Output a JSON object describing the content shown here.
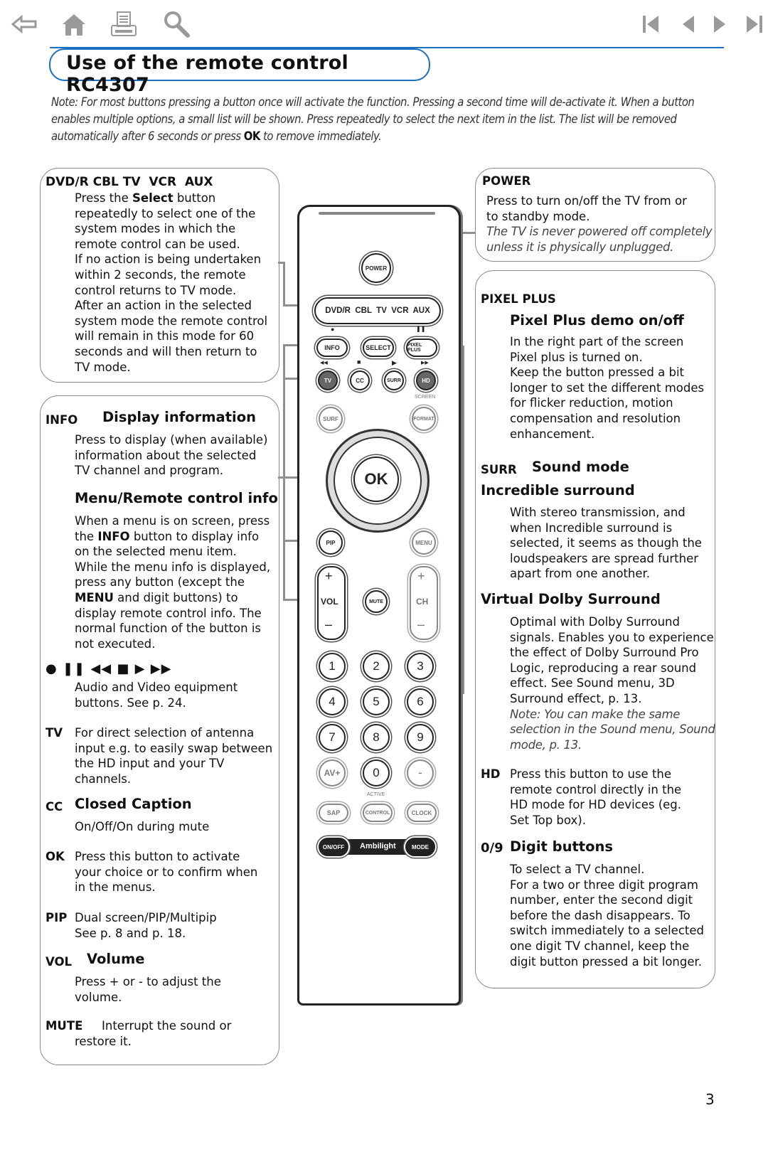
{
  "nav": {
    "left_icons": [
      "back-arrow-icon",
      "home-icon",
      "print-icon",
      "search-icon"
    ],
    "right_icons": [
      "first-page-icon",
      "previous-page-icon",
      "next-page-icon",
      "last-page-icon"
    ]
  },
  "title": "Use of the remote control RC4307",
  "note": {
    "part1": "Note: For most buttons pressing a button once will activate the function. Pressing a second time will de-activate it. When a button enables multiple options, a small list will be shown. Press repeatedly to select the next item in the list. The list will be removed automatically after 6 seconds or press ",
    "bold": "OK",
    "part2": " to remove immediately."
  },
  "left": {
    "modes": {
      "heading": "DVD/R CBL TV  VCR  AUX",
      "lines": [
        [
          "Press the ",
          "Select",
          " button"
        ],
        "repeatedly to select one of the",
        "system modes in which the",
        "remote control can be used.",
        "If no action is being undertaken",
        "within 2 seconds, the remote",
        "control returns to TV mode.",
        "After an action in the selected",
        "system mode the remote control",
        "will remain in this mode for 60",
        "seconds and will then return to",
        "TV mode."
      ]
    },
    "info": {
      "key": "INFO",
      "title": "Display information",
      "body": [
        "Press to display (when available)",
        "information about the selected",
        "TV channel and program."
      ],
      "sub_title": "Menu/Remote control info",
      "sub_body_1": "When a menu is on screen, press",
      "sub_body_2a": "the ",
      "sub_body_2b": "INFO",
      "sub_body_2c": " button to display info",
      "sub_body_3": "on the selected menu item.",
      "sub_body_4": "While the menu info is displayed,",
      "sub_body_5": "press any button (except the",
      "sub_body_6a": "MENU",
      "sub_body_6b": " and digit buttons) to",
      "sub_body_7": "display remote control info. The",
      "sub_body_8": "normal function of the button is",
      "sub_body_9": "not executed."
    },
    "av": {
      "symbols": "● ❚❚ ◀◀ ■ ▶ ▶▶",
      "body": [
        "Audio and Video equipment",
        "buttons. See p. 24."
      ]
    },
    "tv": {
      "key": "TV",
      "body": [
        "For direct selection of antenna",
        "input e.g. to easily swap between",
        "the HD input and your TV",
        "channels."
      ]
    },
    "cc": {
      "key": "CC",
      "title": "Closed Caption",
      "body": "On/Off/On during mute"
    },
    "ok": {
      "key": "OK",
      "body": [
        "Press this button to activate",
        "your choice or to confirm when",
        "in the menus."
      ]
    },
    "pip": {
      "key": "PIP",
      "body": [
        "Dual screen/PIP/Multipip",
        "See p. 8 and p. 18."
      ]
    },
    "vol": {
      "key": "VOL",
      "title": "Volume",
      "body": [
        "Press + or - to adjust the",
        "volume."
      ]
    },
    "mute": {
      "key": "MUTE",
      "body": [
        "Interrupt the sound or",
        "restore it."
      ]
    }
  },
  "right": {
    "power": {
      "key": "POWER",
      "body": [
        "Press to turn on/off the TV from or",
        "to standby mode."
      ],
      "note": [
        "The TV is never powered off completely",
        "unless it is physically unplugged."
      ]
    },
    "pixel": {
      "key": "PIXEL PLUS",
      "title": "Pixel Plus demo on/off",
      "body": [
        "In the right part of the screen",
        "Pixel plus is turned on.",
        "Keep the button pressed a bit",
        "longer to set the different modes",
        "for flicker reduction, motion",
        "compensation and resolution",
        "enhancement."
      ]
    },
    "surr": {
      "key": "SURR",
      "title": "Sound mode",
      "sub1_title": "Incredible surround",
      "sub1_body": [
        "With stereo transmission, and",
        "when Incredible surround is",
        "selected, it seems as though the",
        "loudspeakers are spread further",
        "apart from one another."
      ],
      "sub2_title": "Virtual Dolby Surround",
      "sub2_body": [
        "Optimal with Dolby Surround",
        "signals. Enables you to experience",
        "the effect of Dolby Surround Pro",
        "Logic, reproducing a rear sound",
        "effect. See Sound menu, 3D",
        "Surround effect, p. 13."
      ],
      "sub2_note": [
        "Note: You can make the same",
        "selection in the Sound menu, Sound",
        "mode, p. 13."
      ]
    },
    "hd": {
      "key": "HD",
      "body": [
        "Press this button to use the",
        "remote control directly in the",
        "HD mode for HD devices (eg.",
        "Set Top box)."
      ]
    },
    "digits": {
      "key": "0/9",
      "title": "Digit buttons",
      "body": [
        "To select a TV channel.",
        "For a two or three digit program",
        "number, enter the second digit",
        "before the dash disappears. To",
        "switch immediately to a selected",
        "one digit TV channel, keep the",
        "digit button pressed a bit longer."
      ]
    }
  },
  "remote": {
    "power": "POWER",
    "mode_strip": "DVD/R  CBL  TV  VCR  AUX",
    "info": "INFO",
    "select": "SELECT",
    "pixel_plus": "PIXEL PLUS",
    "rec": "●",
    "pause": "❚❚",
    "rew": "◀◀",
    "stop": "■",
    "play": "▶",
    "ff": "▶▶",
    "tv": "TV",
    "cc": "CC",
    "surr": "SURR",
    "hd": "HD",
    "screen_label": "SCREEN",
    "surf": "SURF",
    "format": "FORMAT",
    "ok": "OK",
    "pip": "PIP",
    "menu": "MENU",
    "vol": "VOL",
    "mute": "MUTE",
    "ch": "CH",
    "plus": "+",
    "minus": "–",
    "digits": [
      "1",
      "2",
      "3",
      "4",
      "5",
      "6",
      "7",
      "8",
      "9"
    ],
    "av": "AV+",
    "zero": "0",
    "dash": "-",
    "active_label": "ACTIVE",
    "sap": "SAP",
    "control": "CONTROL",
    "clock": "CLOCK",
    "onoff": "ON/OFF",
    "ambilight": "Ambilight",
    "mode": "MODE"
  },
  "page_number": "3"
}
